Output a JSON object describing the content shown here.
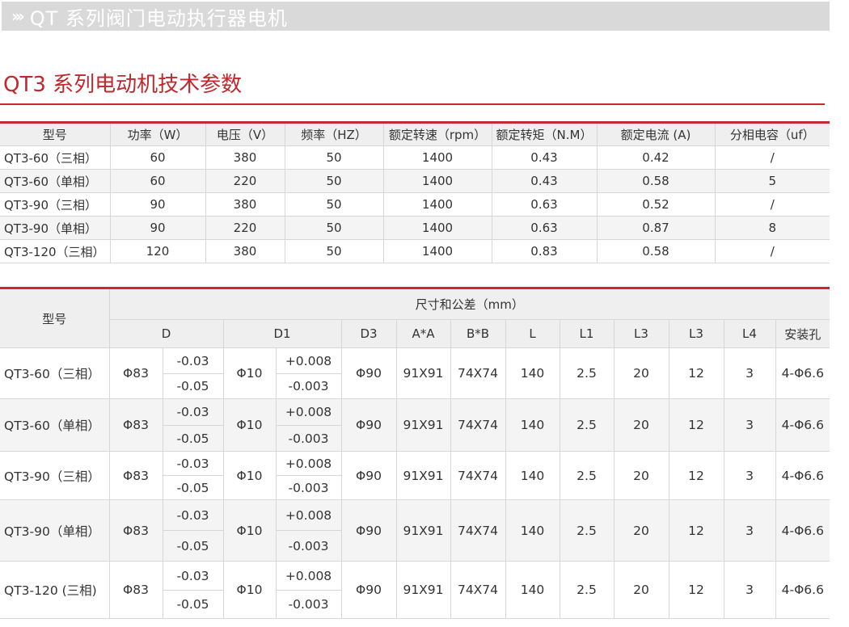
{
  "banner": {
    "chevrons": "›››",
    "title": "QT 系列阀门电动执行器电机"
  },
  "section_title": "QT3 系列电动机技术参数",
  "table1": {
    "headers": [
      "型号",
      "功率（W）",
      "电压（V）",
      "频率（HZ）",
      "额定转速（rpm）",
      "额定转矩（N.M）",
      "额定电流 (A)",
      "分相电容（uf）"
    ],
    "rows": [
      [
        "QT3-60（三相）",
        "60",
        "380",
        "50",
        "1400",
        "0.43",
        "0.42",
        "/"
      ],
      [
        "QT3-60（单相）",
        "60",
        "220",
        "50",
        "1400",
        "0.43",
        "0.58",
        "5"
      ],
      [
        "QT3-90（三相）",
        "90",
        "380",
        "50",
        "1400",
        "0.63",
        "0.52",
        "/"
      ],
      [
        "QT3-90（单相）",
        "90",
        "220",
        "50",
        "1400",
        "0.63",
        "0.87",
        "8"
      ],
      [
        "QT3-120（三相）",
        "120",
        "380",
        "50",
        "1400",
        "0.83",
        "0.58",
        "/"
      ]
    ]
  },
  "table2": {
    "model_header": "型号",
    "group_header": "尺寸和公差（mm）",
    "sub_headers": [
      "D",
      "D1",
      "D3",
      "A*A",
      "B*B",
      "L",
      "L1",
      "L3",
      "L3",
      "L4",
      "安装孔"
    ],
    "rows": [
      {
        "model": "QT3-60（三相）",
        "d": "Φ83",
        "d_tol_a": "-0.03",
        "d_tol_b": "-0.05",
        "d1": "Φ10",
        "d1_tol_a": "+0.008",
        "d1_tol_b": "-0.003",
        "d3": "Φ90",
        "aa": "91X91",
        "bb": "74X74",
        "l": "140",
        "l1": "2.5",
        "l3a": "20",
        "l3b": "12",
        "l4": "3",
        "hole": "4-Φ6.6"
      },
      {
        "model": "QT3-60（单相）",
        "d": "Φ83",
        "d_tol_a": "-0.03",
        "d_tol_b": "-0.05",
        "d1": "Φ10",
        "d1_tol_a": "+0.008",
        "d1_tol_b": "-0.003",
        "d3": "Φ90",
        "aa": "91X91",
        "bb": "74X74",
        "l": "140",
        "l1": "2.5",
        "l3a": "20",
        "l3b": "12",
        "l4": "3",
        "hole": "4-Φ6.6"
      },
      {
        "model": "QT3-90（三相）",
        "d": "Φ83",
        "d_tol_a": "-0.03",
        "d_tol_b": "-0.05",
        "d1": "Φ10",
        "d1_tol_a": "+0.008",
        "d1_tol_b": "-0.003",
        "d3": "Φ90",
        "aa": "91X91",
        "bb": "74X74",
        "l": "140",
        "l1": "2.5",
        "l3a": "20",
        "l3b": "12",
        "l4": "3",
        "hole": "4-Φ6.6"
      },
      {
        "model": "QT3-90（单相）",
        "d": "Φ83",
        "d_tol_a": "-0.03",
        "d_tol_b": "-0.05",
        "d1": "Φ10",
        "d1_tol_a": "+0.008",
        "d1_tol_b": "-0.003",
        "d3": "Φ90",
        "aa": "91X91",
        "bb": "74X74",
        "l": "140",
        "l1": "2.5",
        "l3a": "20",
        "l3b": "12",
        "l4": "3",
        "hole": "4-Φ6.6"
      },
      {
        "model": "QT3-120 (三相)",
        "d": "Φ83",
        "d_tol_a": "-0.03",
        "d_tol_b": "-0.05",
        "d1": "Φ10",
        "d1_tol_a": "+0.008",
        "d1_tol_b": "-0.003",
        "d3": "Φ90",
        "aa": "91X91",
        "bb": "74X74",
        "l": "140",
        "l1": "2.5",
        "l3a": "20",
        "l3b": "12",
        "l4": "3",
        "hole": "4-Φ6.6"
      }
    ]
  },
  "colors": {
    "accent": "#c8282f",
    "title": "#c1272d",
    "banner_bg": "#d9d9d9",
    "header_bg": "#efefef",
    "stripe_bg": "#f4f4f4",
    "border": "#d7d7d7"
  }
}
